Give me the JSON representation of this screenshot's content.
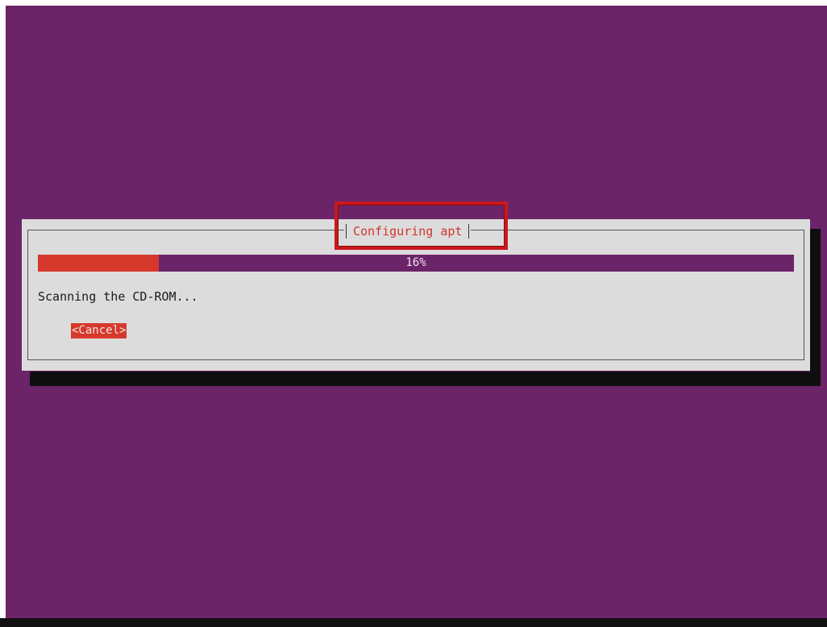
{
  "dialog": {
    "title": "Configuring apt",
    "status": "Scanning the CD-ROM...",
    "cancel_label": "<Cancel>"
  },
  "progress": {
    "percent": 16,
    "label": "16%"
  },
  "colors": {
    "background": "#6c2469",
    "dialog_bg": "#dddcdc",
    "accent": "#d6382b",
    "annotation_border": "#c8191d"
  }
}
